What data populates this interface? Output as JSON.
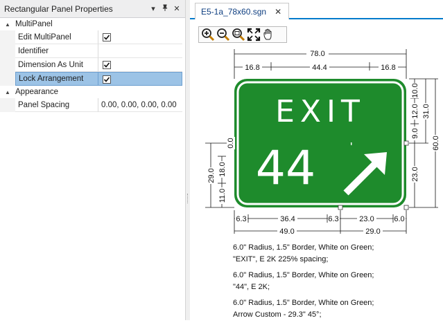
{
  "panel": {
    "title": "Rectangular Panel Properties",
    "controls": {
      "dropdown": "▾",
      "pin": "📌",
      "close": "✕"
    },
    "categories": [
      {
        "name": "MultiPanel",
        "rows": [
          {
            "label": "Edit MultiPanel",
            "checked": true
          },
          {
            "label": "Identifier",
            "value": ""
          },
          {
            "label": "Dimension As Unit",
            "checked": true
          },
          {
            "label": "Lock Arrangement",
            "checked": true,
            "selected": true
          }
        ]
      },
      {
        "name": "Appearance",
        "rows": [
          {
            "label": "Panel Spacing",
            "value": "0.00, 0.00, 0.00, 0.00"
          }
        ]
      }
    ]
  },
  "document": {
    "tab_label": "E5-1a_78x60.sgn",
    "tab_close": "✕",
    "accent": "#007acc",
    "toolbar_icons": [
      "zoom-in-icon",
      "zoom-out-icon",
      "zoom-window-icon",
      "zoom-extents-icon",
      "pan-hand-icon"
    ]
  },
  "sign": {
    "line1": "EXIT",
    "line2": "44",
    "apostrophe": "'",
    "background": "#1e8b2c",
    "foreground": "#ffffff"
  },
  "dimensions": {
    "top_overall": "78.0",
    "top_left": "16.8",
    "top_mid": "44.4",
    "top_right": "16.8",
    "right_1": "10.0",
    "right_2": "12.0",
    "right_3": "9.0",
    "right_4": "23.0",
    "right_inner": "31.0",
    "right_overall": "60.0",
    "left_top": "0.0",
    "left_1": "29.0",
    "left_2": "18.0",
    "left_3": "11.0",
    "bottom_1": "6.3",
    "bottom_2": "36.4",
    "bottom_3": "6.3",
    "bottom_4": "23.0",
    "bottom_5": "6.0",
    "bottom_left": "49.0",
    "bottom_right": "29.0"
  },
  "notes": [
    {
      "line1": "6.0\" Radius, 1.5\" Border, White on Green;",
      "line2": "\"EXIT\",   E  2K  225% spacing;"
    },
    {
      "line1": "6.0\" Radius, 1.5\" Border, White on Green;",
      "line2": "\"44\",   E  2K;"
    },
    {
      "line1": "6.0\" Radius, 1.5\" Border, White on Green;",
      "line2": "Arrow Custom - 29.3\" 45°;"
    }
  ]
}
